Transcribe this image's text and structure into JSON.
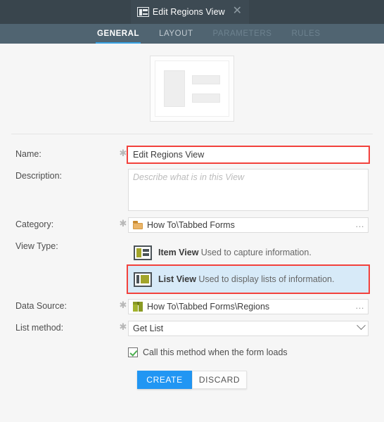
{
  "window": {
    "tab": {
      "title": "Edit Regions View",
      "icon": "item-view-icon",
      "close_label": "✕"
    }
  },
  "nav": {
    "tabs": [
      {
        "label": "GENERAL",
        "state": "active"
      },
      {
        "label": "LAYOUT",
        "state": "enabled"
      },
      {
        "label": "PARAMETERS",
        "state": "disabled"
      },
      {
        "label": "RULES",
        "state": "disabled"
      }
    ],
    "active_underline_color": "#3aa3e3"
  },
  "preview": {
    "icon": "item-view-preview"
  },
  "form": {
    "name": {
      "label": "Name:",
      "required_marker": "✱",
      "value": "Edit Regions View",
      "highlighted": true
    },
    "description": {
      "label": "Description:",
      "placeholder": "Describe what is in this View",
      "value": ""
    },
    "category": {
      "label": "Category:",
      "required_marker": "✱",
      "value": "How To\\Tabbed Forms",
      "icon": "folder-icon",
      "browse_label": "…"
    },
    "view_type": {
      "label": "View Type:",
      "options": [
        {
          "title": "Item View",
          "description": "Used to capture information.",
          "icon": "item-view-icon",
          "selected": false
        },
        {
          "title": "List View",
          "description": "Used to display lists of information.",
          "icon": "list-view-icon",
          "selected": true
        }
      ]
    },
    "data_source": {
      "label": "Data Source:",
      "required_marker": "✱",
      "value": "How To\\Tabbed Forms\\Regions",
      "icon": "cube-icon",
      "browse_label": "…"
    },
    "list_method": {
      "label": "List method:",
      "required_marker": "✱",
      "value": "Get List",
      "icon": "chevron-down-icon"
    },
    "call_on_load": {
      "label": "Call this method when the form loads",
      "checked": true
    }
  },
  "actions": {
    "create_label": "CREATE",
    "discard_label": "DISCARD"
  },
  "colors": {
    "titlebar": "#39454d",
    "navbar": "#506471",
    "accent": "#2196f3",
    "highlight_border": "#f2413c",
    "selection_bg": "#d7eaf8",
    "icon_olive": "#a3a52a",
    "icon_folder": "#eab468",
    "icon_cube": "#a3b32e",
    "check_green": "#4caf50"
  }
}
